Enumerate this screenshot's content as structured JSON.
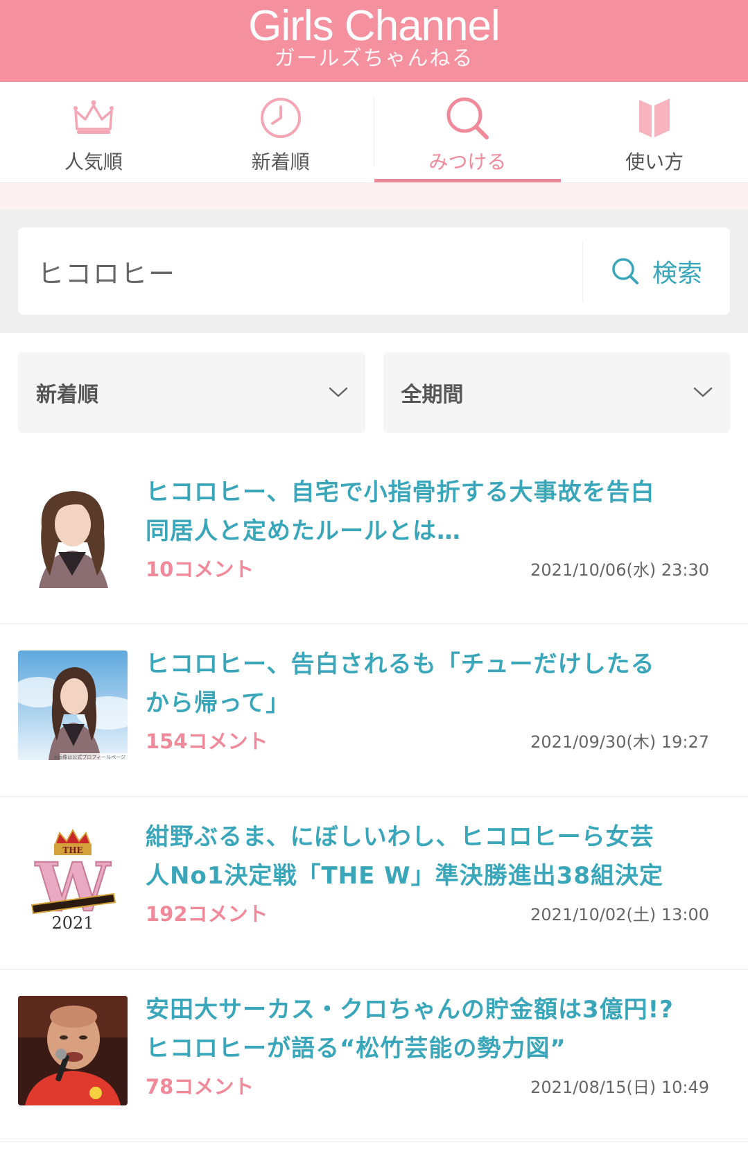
{
  "header": {
    "logo_en": "Girls Channel",
    "logo_ja": "ガールズちゃんねる"
  },
  "nav": {
    "tabs": [
      {
        "label": "人気順",
        "icon": "crown-icon"
      },
      {
        "label": "新着順",
        "icon": "clock-icon"
      },
      {
        "label": "みつける",
        "icon": "search-icon",
        "active": true
      },
      {
        "label": "使い方",
        "icon": "book-icon"
      }
    ]
  },
  "search": {
    "value": "ヒコロヒー",
    "button_label": "検索"
  },
  "filters": {
    "sort": "新着順",
    "period": "全期間"
  },
  "colors": {
    "brand_pink": "#f5919f",
    "accent_teal": "#3aa6b9",
    "comment_pink": "#f08a9a"
  },
  "articles": [
    {
      "title_line1": "ヒコロヒー、自宅で小指骨折する大事故を告白",
      "title_line2": "同居人と定めたルールとは…",
      "comments": "10コメント",
      "date": "2021/10/06(水) 23:30",
      "thumb": "woman-portrait"
    },
    {
      "title_line1": "ヒコロヒー、告白されるも「チューだけしたる",
      "title_line2": "から帰って」",
      "comments": "154コメント",
      "date": "2021/09/30(木) 19:27",
      "thumb": "woman-portrait-sky",
      "thumb_caption": "※画像は公式プロフィールページ"
    },
    {
      "title_line1": "紺野ぶるま、にぼしいわし、ヒコロヒーら女芸",
      "title_line2": "人No1決定戦「THE W」準決勝進出38組決定",
      "comments": "192コメント",
      "date": "2021/10/02(土) 13:00",
      "thumb": "the-w-logo",
      "thumb_text": "THE",
      "thumb_letter": "W",
      "thumb_year": "2021"
    },
    {
      "title_line1": "安田大サーカス・クロちゃんの貯金額は3億円!?",
      "title_line2": "ヒコロヒーが語る“松竹芸能の勢力図”",
      "comments": "78コメント",
      "date": "2021/08/15(日) 10:49",
      "thumb": "man-with-microphone"
    }
  ]
}
